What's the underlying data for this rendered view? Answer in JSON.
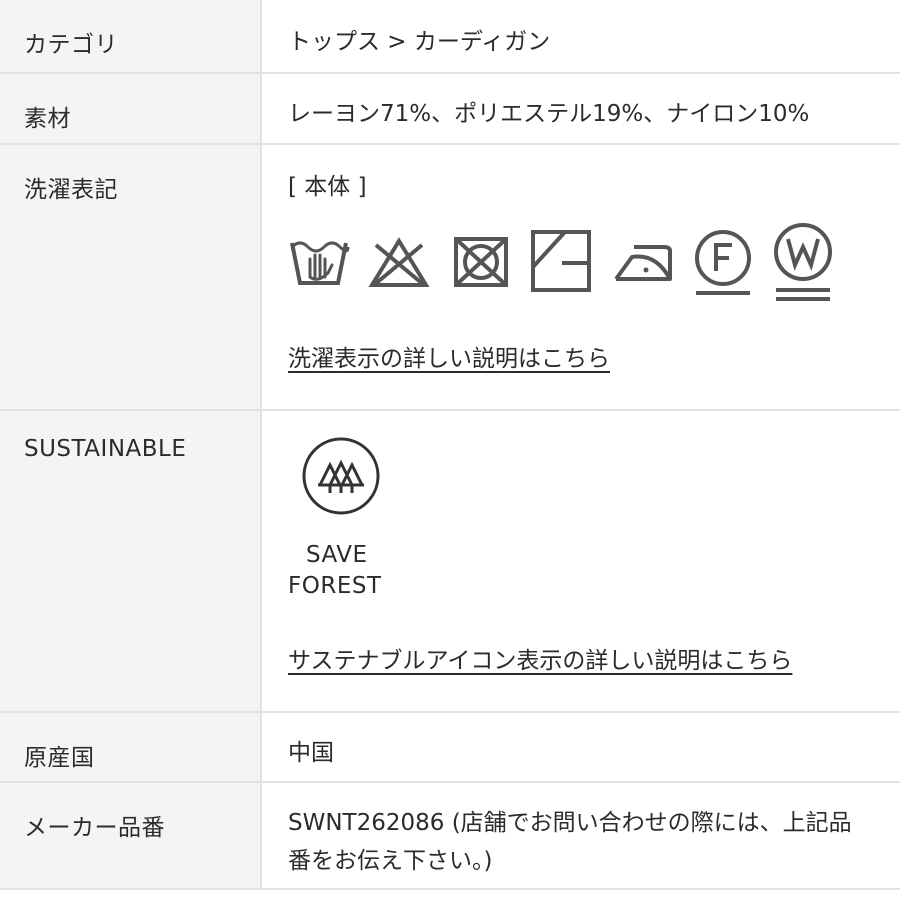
{
  "rows": {
    "category": {
      "label": "カテゴリ",
      "value": "トップス > カーディガン"
    },
    "material": {
      "label": "素材",
      "value": "レーヨン71%、ポリエステル19%、ナイロン10%"
    },
    "care": {
      "label": "洗濯表記",
      "section_label": "[ 本体 ]",
      "icons": [
        "hand-wash-icon",
        "no-bleach-icon",
        "no-tumble-dry-icon",
        "line-dry-shade-icon",
        "iron-low-icon",
        "dry-clean-f-icon",
        "wet-clean-w-icon"
      ],
      "link_text": "洗濯表示の詳しい説明はこちら"
    },
    "sustainable": {
      "label": "SUSTAINABLE",
      "badge_line1": "SAVE",
      "badge_line2": "FOREST",
      "badge_icon": "trees-circle-icon",
      "link_text": "サステナブルアイコン表示の詳しい説明はこちら"
    },
    "origin": {
      "label": "原産国",
      "value": "中国"
    },
    "maker_number": {
      "label": "メーカー品番",
      "value_line1": "SWNT262086 (店舗でお問い合わせの際には、上記品",
      "value_line2": "番をお伝え下さい。)"
    }
  },
  "colors": {
    "label_bg": "#f4f4f4",
    "border": "#e2e2e2",
    "text": "#2b2b2b",
    "icon_stroke": "#555555"
  }
}
